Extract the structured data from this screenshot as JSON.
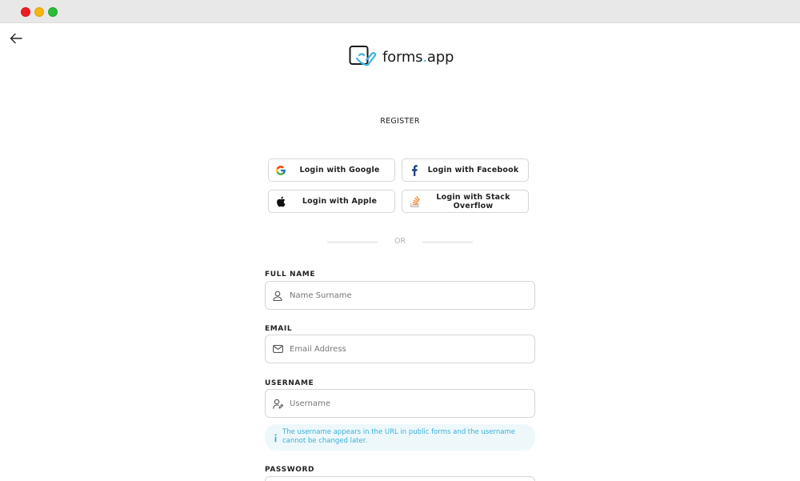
{
  "logo": {
    "name": "forms",
    "dot": ".",
    "suffix": "app"
  },
  "page_title": "REGISTER",
  "social": {
    "google": "Login with Google",
    "facebook": "Login with Facebook",
    "apple": "Login with Apple",
    "stackoverflow": "Login with Stack Overflow"
  },
  "divider_text": "OR",
  "form": {
    "full_name": {
      "label": "FULL NAME",
      "placeholder": "Name Surname",
      "value": ""
    },
    "email": {
      "label": "EMAIL",
      "placeholder": "Email Address",
      "value": ""
    },
    "username": {
      "label": "USERNAME",
      "placeholder": "Username",
      "value": "",
      "hint": "The username appears in the URL in public forms and the username cannot be changed later."
    },
    "password": {
      "label": "PASSWORD"
    }
  },
  "icons": {
    "back": "arrow-left-icon",
    "google": "google-icon",
    "facebook": "facebook-icon",
    "apple": "apple-icon",
    "stackoverflow": "stackoverflow-icon",
    "user": "user-icon",
    "mail": "mail-icon",
    "username": "user-edit-icon",
    "info": "info-icon"
  },
  "colors": {
    "accent": "#3cb4e6",
    "hint_text": "#3ab0d8",
    "hint_bg": "#eef8fb",
    "facebook": "#1d3f8a",
    "stackoverflow": "#f48024"
  }
}
